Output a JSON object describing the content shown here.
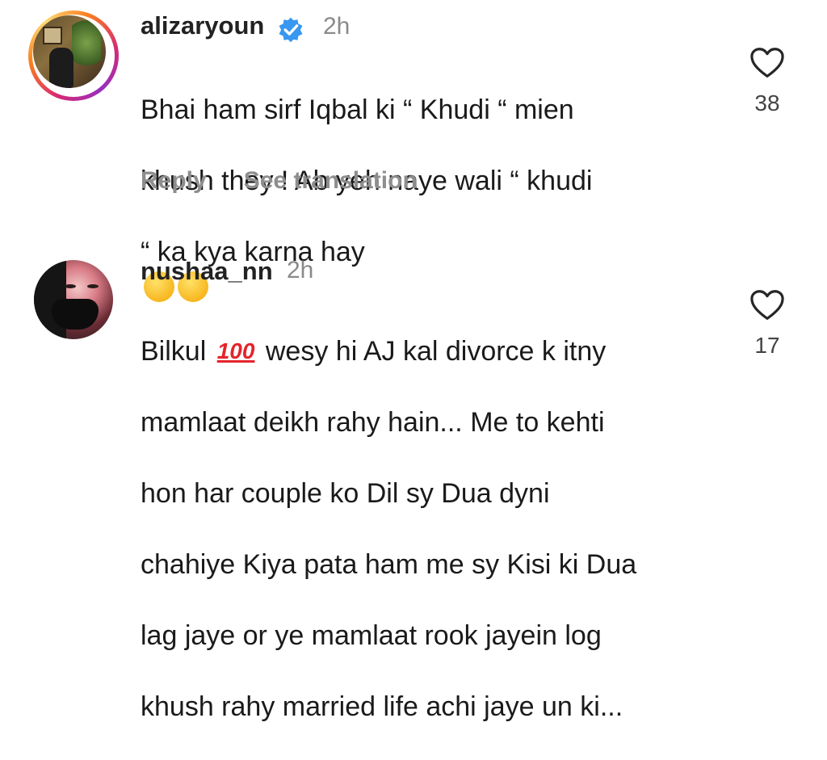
{
  "comments": [
    {
      "username": "alizaryoun",
      "verified": true,
      "time": "2h",
      "text_line1": "Bhai ham sirf Iqbal ki “ Khudi “ mien",
      "text_line2": "khush they ! Ab yeh naye wali “ khudi",
      "text_line3": "“ ka kya karna hay",
      "emojis": [
        "thinking-face-emoji",
        "rolling-laughing-emoji"
      ],
      "likes": "38",
      "reply_label": "Reply",
      "translate_label": "See translation"
    },
    {
      "username": "nushaa_nn",
      "verified": false,
      "time": "2h",
      "text_prefix": "Bilkul",
      "hundred": "100",
      "text_line1_rest": "wesy hi AJ kal divorce k itny",
      "text_line2": "mamlaat deikh rahy hain... Me to kehti",
      "text_line3": "hon har couple ko Dil sy Dua dyni",
      "text_line4": "chahiye Kiya pata ham me sy Kisi ki Dua",
      "text_line5": "lag jaye or ye mamlaat rook jayein log",
      "text_line6": "khush rahy married life achi jaye un ki...",
      "likes": "17"
    }
  ],
  "colors": {
    "verified_blue": "#3897f0",
    "muted_gray": "#8e8e8e"
  }
}
